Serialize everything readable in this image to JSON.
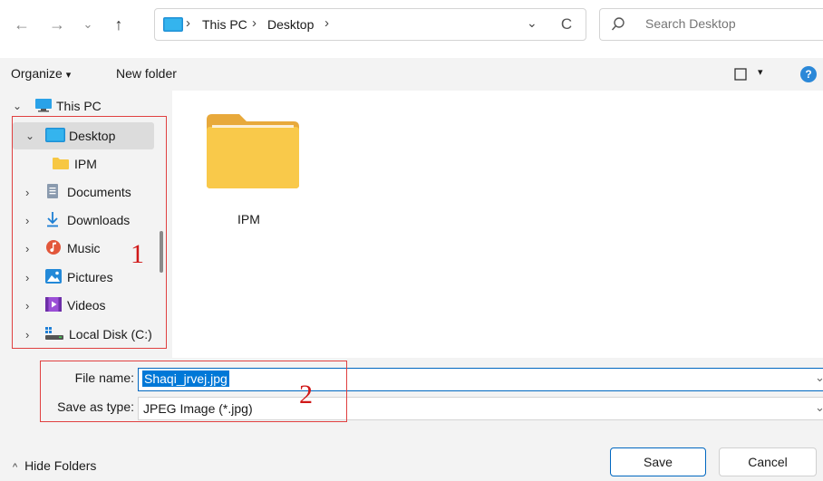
{
  "nav": {
    "back": "←",
    "forward": "→",
    "recent": "⌄",
    "up": "↑",
    "refresh": "C"
  },
  "address": {
    "parts": [
      "This PC",
      "Desktop"
    ],
    "separator": "›",
    "dropdown": "⌄"
  },
  "search": {
    "placeholder": "Search Desktop"
  },
  "toolbar": {
    "organize": "Organize",
    "organize_caret": "▾",
    "new_folder": "New folder",
    "view_caret": "▾",
    "help": "?"
  },
  "tree": {
    "root": "This PC",
    "items": [
      {
        "label": "Desktop",
        "icon": "desktop-icon"
      },
      {
        "label": "IPM",
        "icon": "folder-icon"
      },
      {
        "label": "Documents",
        "icon": "documents-icon"
      },
      {
        "label": "Downloads",
        "icon": "downloads-icon"
      },
      {
        "label": "Music",
        "icon": "music-icon"
      },
      {
        "label": "Pictures",
        "icon": "pictures-icon"
      },
      {
        "label": "Videos",
        "icon": "videos-icon"
      },
      {
        "label": "Local Disk (C:)",
        "icon": "drive-icon"
      }
    ]
  },
  "files": [
    {
      "name": "IPM",
      "icon": "folder-icon"
    }
  ],
  "annotations": {
    "one": "1",
    "two": "2"
  },
  "form": {
    "file_name_label": "File name:",
    "file_name_value": "Shaqi_jrvej.jpg",
    "save_type_label": "Save as type:",
    "save_type_value": "JPEG Image (*.jpg)"
  },
  "footer": {
    "hide_folders": "Hide Folders",
    "save": "Save",
    "cancel": "Cancel"
  },
  "colors": {
    "accent": "#0067c0",
    "selection": "#0078d7",
    "annotation": "#d01818",
    "folder": "#f7c743"
  }
}
